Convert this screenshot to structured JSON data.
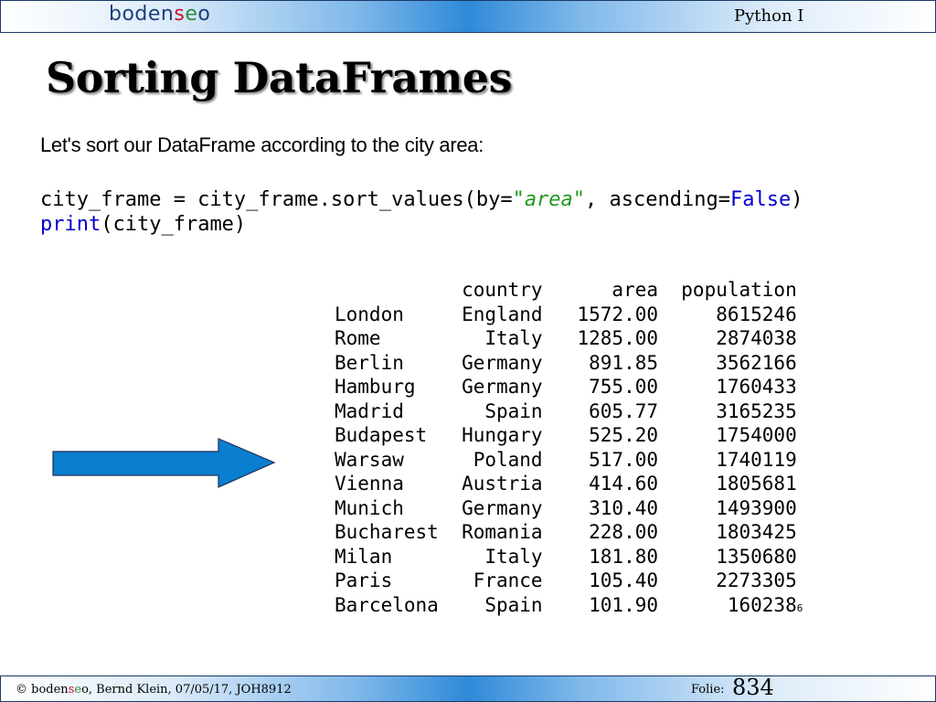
{
  "header": {
    "logo": {
      "part1": "boden",
      "part2": "s",
      "part3": "e",
      "part4": "o"
    },
    "course": "Python I"
  },
  "slide": {
    "title": "Sorting DataFrames",
    "intro": "Let's sort our DataFrame according to the city area:",
    "code": {
      "line1_a": "city_frame = city_frame.sort_values(by=",
      "line1_str_open": "\"",
      "line1_str": "area",
      "line1_str_close": "\"",
      "line1_b": ", ascending=",
      "line1_false": "False",
      "line1_c": ")",
      "line2_kw": "print",
      "line2_rest": "(city_frame)"
    },
    "output": {
      "columns": [
        "country",
        "area",
        "population"
      ],
      "rows": [
        {
          "city": "London",
          "country": "England",
          "area": "1572.00",
          "population": "8615246"
        },
        {
          "city": "Rome",
          "country": "Italy",
          "area": "1285.00",
          "population": "2874038"
        },
        {
          "city": "Berlin",
          "country": "Germany",
          "area": "891.85",
          "population": "3562166"
        },
        {
          "city": "Hamburg",
          "country": "Germany",
          "area": "755.00",
          "population": "1760433"
        },
        {
          "city": "Madrid",
          "country": "Spain",
          "area": "605.77",
          "population": "3165235"
        },
        {
          "city": "Budapest",
          "country": "Hungary",
          "area": "525.20",
          "population": "1754000"
        },
        {
          "city": "Warsaw",
          "country": "Poland",
          "area": "517.00",
          "population": "1740119"
        },
        {
          "city": "Vienna",
          "country": "Austria",
          "area": "414.60",
          "population": "1805681"
        },
        {
          "city": "Munich",
          "country": "Germany",
          "area": "310.40",
          "population": "1493900"
        },
        {
          "city": "Bucharest",
          "country": "Romania",
          "area": "228.00",
          "population": "1803425"
        },
        {
          "city": "Milan",
          "country": "Italy",
          "area": "181.80",
          "population": "1350680"
        },
        {
          "city": "Paris",
          "country": "France",
          "area": "105.40",
          "population": "2273305"
        },
        {
          "city": "Barcelona",
          "country": "Spain",
          "area": "101.90",
          "population": "160238"
        }
      ],
      "trailing_digit": "6"
    },
    "arrow_color": "#0a7fd0"
  },
  "footer": {
    "copyright": "©",
    "brand": {
      "part1": "boden",
      "part2": "s",
      "part3": "e",
      "part4": "o"
    },
    "info": ", Bernd Klein, 07/05/17, JOH8912",
    "folie_label": "Folie:",
    "folie_number": "834"
  }
}
